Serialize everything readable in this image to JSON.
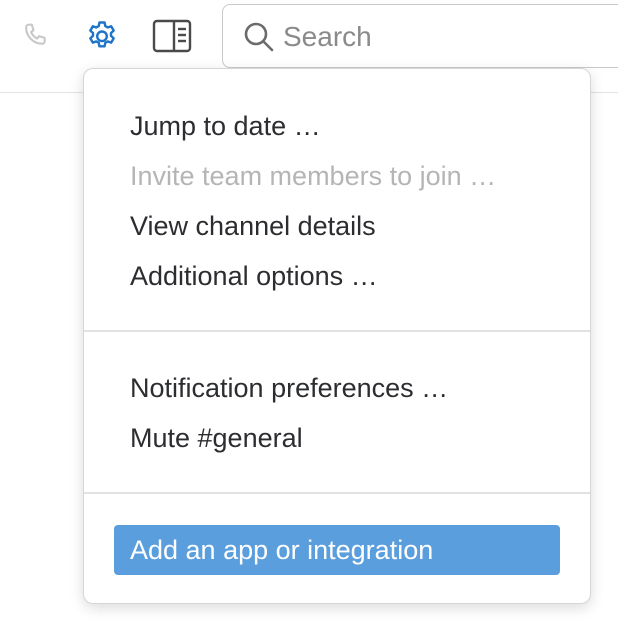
{
  "toolbar": {
    "call_icon": "phone-icon",
    "settings_icon": "gear-icon",
    "details_icon": "sidebar-panel-icon",
    "search": {
      "placeholder": "Search",
      "icon": "search-icon"
    }
  },
  "menu": {
    "group1": [
      {
        "label": "Jump to date …",
        "disabled": false
      },
      {
        "label": "Invite team members to join …",
        "disabled": true
      },
      {
        "label": "View channel details",
        "disabled": false
      },
      {
        "label": "Additional options …",
        "disabled": false
      }
    ],
    "group2": [
      {
        "label": "Notification preferences …",
        "disabled": false
      },
      {
        "label": "Mute #general",
        "disabled": false
      }
    ],
    "group3": [
      {
        "label": "Add an app or integration",
        "highlighted": true
      }
    ]
  },
  "colors": {
    "accent": "#1d74c8",
    "highlight": "#5b9ede",
    "disabled_text": "#b5b5b5",
    "text": "#2c2d30"
  }
}
